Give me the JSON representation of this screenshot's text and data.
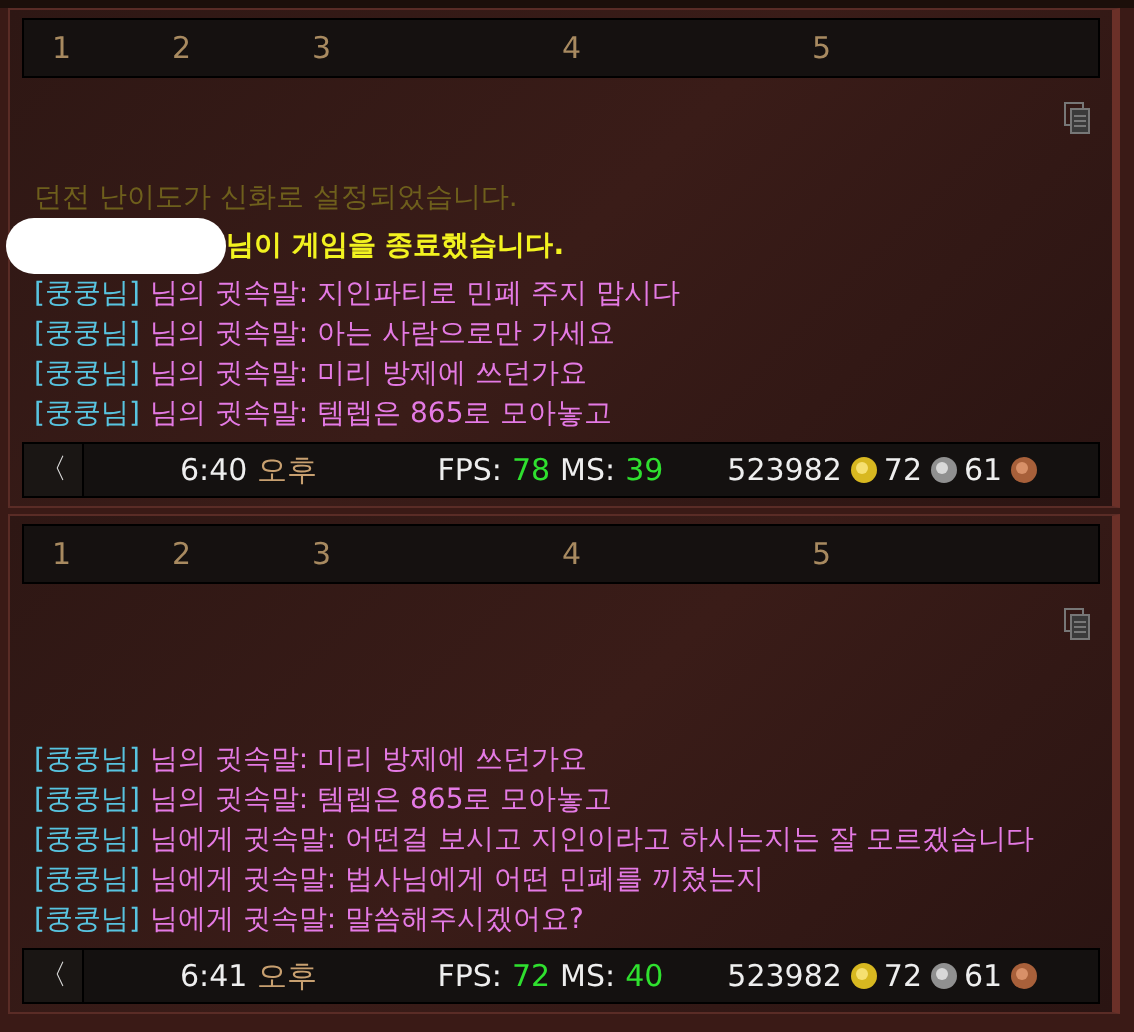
{
  "panels": [
    {
      "tabs": [
        "1",
        "2",
        "3",
        "4",
        "5"
      ],
      "messages": [
        {
          "kind": "notice",
          "faded": true,
          "text": "던전 난이도가 신화로 설정되었습니다."
        },
        {
          "kind": "notice",
          "faded": false,
          "redacted": true,
          "text": "님이 게임을 종료했습니다."
        },
        {
          "kind": "whisper",
          "name": "[쿵쿵님]",
          "text": "님의 귓속말: 지인파티로 민폐 주지 맙시다"
        },
        {
          "kind": "whisper",
          "name": "[쿵쿵님]",
          "text": "님의 귓속말: 아는 사람으로만 가세요"
        },
        {
          "kind": "whisper",
          "name": "[쿵쿵님]",
          "text": "님의 귓속말: 미리 방제에 쓰던가요"
        },
        {
          "kind": "whisper",
          "name": "[쿵쿵님]",
          "text": "님의 귓속말: 템렙은 865로 모아놓고"
        }
      ],
      "status": {
        "back": "〈",
        "time": "6:40",
        "period": "오후",
        "fps_label": "FPS:",
        "fps": "78",
        "ms_label": "MS:",
        "ms": "39",
        "gold": "523982",
        "silver": "72",
        "copper": "61"
      }
    },
    {
      "tabs": [
        "1",
        "2",
        "3",
        "4",
        "5"
      ],
      "messages": [
        {
          "kind": "whisper",
          "name": "[쿵쿵님]",
          "text": "님의 귓속말: 미리 방제에 쓰던가요"
        },
        {
          "kind": "whisper",
          "name": "[쿵쿵님]",
          "text": "님의 귓속말: 템렙은 865로 모아놓고"
        },
        {
          "kind": "whisper",
          "name": "[쿵쿵님]",
          "text": "님에게 귓속말: 어떤걸 보시고 지인이라고 하시는지는 잘 모르겠습니다"
        },
        {
          "kind": "whisper",
          "name": "[쿵쿵님]",
          "text": "님에게 귓속말: 법사님에게 어떤 민폐를 끼쳤는지"
        },
        {
          "kind": "whisper",
          "name": "[쿵쿵님]",
          "text": "님에게 귓속말: 말씀해주시겠어요?"
        }
      ],
      "status": {
        "back": "〈",
        "time": "6:41",
        "period": "오후",
        "fps_label": "FPS:",
        "fps": "72",
        "ms_label": "MS:",
        "ms": "40",
        "gold": "523982",
        "silver": "72",
        "copper": "61"
      }
    }
  ]
}
